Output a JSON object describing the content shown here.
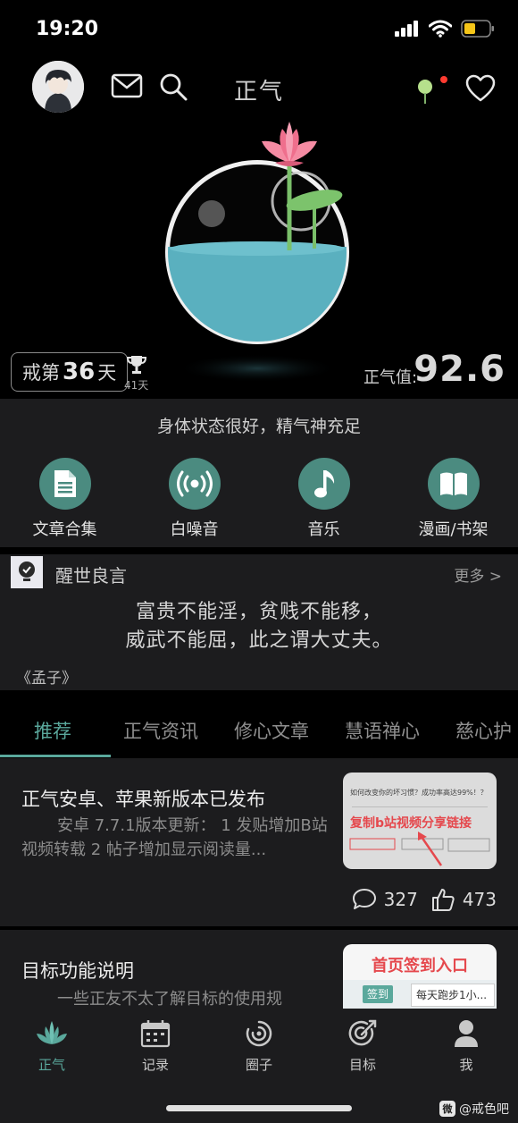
{
  "status_bar": {
    "time": "19:20"
  },
  "header": {
    "title": "正气"
  },
  "hero": {
    "streak_prefix": "戒第",
    "streak_days": "36",
    "streak_suffix": "天",
    "best_streak": "41天",
    "score_label": "正气值:",
    "score_value": "92.6"
  },
  "status": {
    "message": "身体状态很好，精气神充足",
    "shortcuts": [
      {
        "label": "文章合集",
        "icon": "document-icon"
      },
      {
        "label": "白噪音",
        "icon": "broadcast-icon"
      },
      {
        "label": "音乐",
        "icon": "music-note-icon"
      },
      {
        "label": "漫画/书架",
        "icon": "book-icon"
      }
    ]
  },
  "quote": {
    "title": "醒世良言",
    "more": "更多 >",
    "lines": [
      "富贵不能淫，贫贱不能移，",
      "威武不能屈，此之谓大丈夫。"
    ],
    "source": "《孟子》"
  },
  "tabs": [
    {
      "label": "推荐",
      "active": true
    },
    {
      "label": "正气资讯"
    },
    {
      "label": "修心文章"
    },
    {
      "label": "慧语禅心"
    },
    {
      "label": "慈心护"
    }
  ],
  "feed": [
    {
      "title": "正气安卓、苹果新版本已发布",
      "body": "安卓 7.7.1版本更新： 1 发贴增加B站视频转载 2 帖子增加显示阅读量...",
      "thumb_caption": "复制b站视频分享链接",
      "thumb_question": "如何改变你的坏习惯？成功率高达99%！？",
      "comments": "327",
      "likes": "473"
    },
    {
      "title": "目标功能说明",
      "body": "一些正友不太了解目标的使用规",
      "thumb_title": "首页签到入口",
      "thumb_button": "签到",
      "thumb_item": "每天跑步1小..."
    }
  ],
  "bottom_nav": [
    {
      "label": "正气",
      "icon": "lotus-icon",
      "active": true
    },
    {
      "label": "记录",
      "icon": "calendar-icon"
    },
    {
      "label": "圈子",
      "icon": "circle-icon"
    },
    {
      "label": "目标",
      "icon": "target-icon"
    },
    {
      "label": "我",
      "icon": "person-icon"
    }
  ],
  "watermark": "@戒色吧",
  "colors": {
    "accent": "#5aa89c",
    "water": "#5ab0bf",
    "lotus": "#f07a95"
  }
}
